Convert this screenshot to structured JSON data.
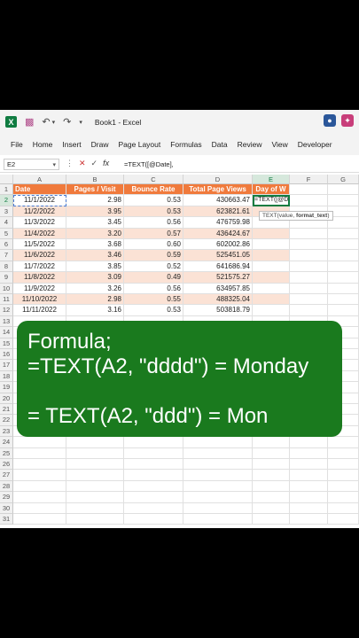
{
  "title_bar": {
    "app_icon_letter": "X",
    "title": "Book1 - Excel"
  },
  "menu": [
    "File",
    "Home",
    "Insert",
    "Draw",
    "Page Layout",
    "Formulas",
    "Data",
    "Review",
    "View",
    "Developer"
  ],
  "formula_bar": {
    "name_box": "E2",
    "formula": "=TEXT([@Date],"
  },
  "columns": [
    "A",
    "B",
    "C",
    "D",
    "E",
    "F",
    "G"
  ],
  "row_numbers": [
    "1",
    "2",
    "3",
    "4",
    "5",
    "6",
    "7",
    "8",
    "9",
    "10",
    "11",
    "12",
    "13",
    "14",
    "15",
    "16",
    "17",
    "18",
    "19",
    "20",
    "21",
    "22",
    "23",
    "24",
    "25",
    "26",
    "27",
    "28",
    "29",
    "30",
    "31"
  ],
  "table": {
    "headers": [
      "Date",
      "Pages / Visit",
      "Bounce Rate",
      "Total Page Views",
      "Day of W"
    ],
    "rows": [
      [
        "11/1/2022",
        "2.98",
        "0.53",
        "430663.47",
        "=TEXT([@Date],"
      ],
      [
        "11/2/2022",
        "3.95",
        "0.53",
        "623821.61",
        ""
      ],
      [
        "11/3/2022",
        "3.45",
        "0.56",
        "476759.98",
        ""
      ],
      [
        "11/4/2022",
        "3.20",
        "0.57",
        "436424.67",
        ""
      ],
      [
        "11/5/2022",
        "3.68",
        "0.60",
        "602002.86",
        ""
      ],
      [
        "11/6/2022",
        "3.46",
        "0.59",
        "525451.05",
        ""
      ],
      [
        "11/7/2022",
        "3.85",
        "0.52",
        "641686.94",
        ""
      ],
      [
        "11/8/2022",
        "3.09",
        "0.49",
        "521575.27",
        ""
      ],
      [
        "11/9/2022",
        "3.26",
        "0.56",
        "634957.85",
        ""
      ],
      [
        "11/10/2022",
        "2.98",
        "0.55",
        "488325.04",
        ""
      ],
      [
        "11/11/2022",
        "3.16",
        "0.53",
        "503818.79",
        ""
      ]
    ]
  },
  "tooltip": {
    "text_plain": "TEXT(value, ",
    "text_bold": "format_text",
    "text_end": ")"
  },
  "overlay": {
    "line1": "Formula;",
    "line2": "=TEXT(A2, \"dddd\") = Monday",
    "line3": "= TEXT(A2, \"ddd\") = Mon"
  }
}
